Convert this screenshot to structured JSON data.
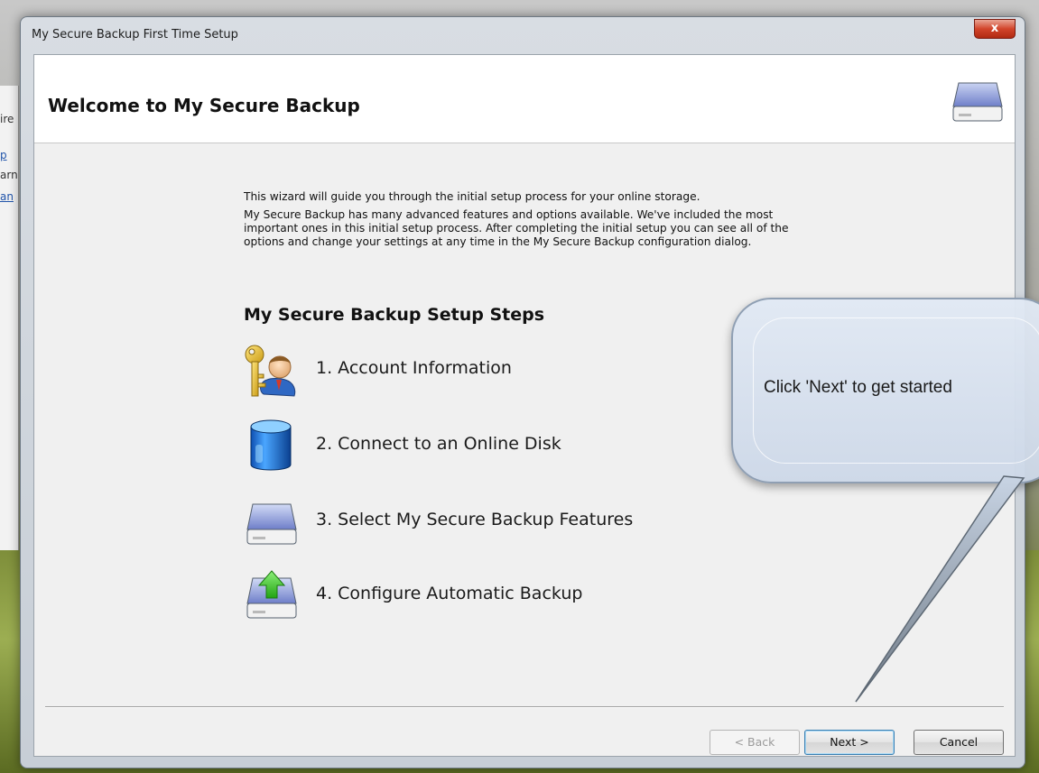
{
  "background_window": {
    "lines": [
      "ire",
      "p",
      "arn",
      "an"
    ]
  },
  "window": {
    "title": "My Secure Backup First Time Setup",
    "close_label": "x"
  },
  "header": {
    "title": "Welcome to My Secure Backup"
  },
  "intro": {
    "line1": "This wizard will guide you through the initial setup process for your online storage.",
    "line2": "My Secure Backup has many advanced features and options available. We've included the most important ones in this initial setup process. After completing the initial setup you can see all of the options and change your settings at any time in the My Secure Backup configuration dialog."
  },
  "steps": {
    "title": "My Secure Backup Setup Steps",
    "items": [
      {
        "label": "1. Account Information",
        "icon": "key-user-icon"
      },
      {
        "label": "2. Connect to an Online Disk",
        "icon": "disk-cylinder-icon"
      },
      {
        "label": "3. Select My Secure Backup Features",
        "icon": "drive-icon"
      },
      {
        "label": "4. Configure Automatic Backup",
        "icon": "drive-upload-icon"
      }
    ]
  },
  "buttons": {
    "back": "< Back",
    "next": "Next >",
    "cancel": "Cancel"
  },
  "callout": {
    "text": "Click 'Next' to get started"
  }
}
